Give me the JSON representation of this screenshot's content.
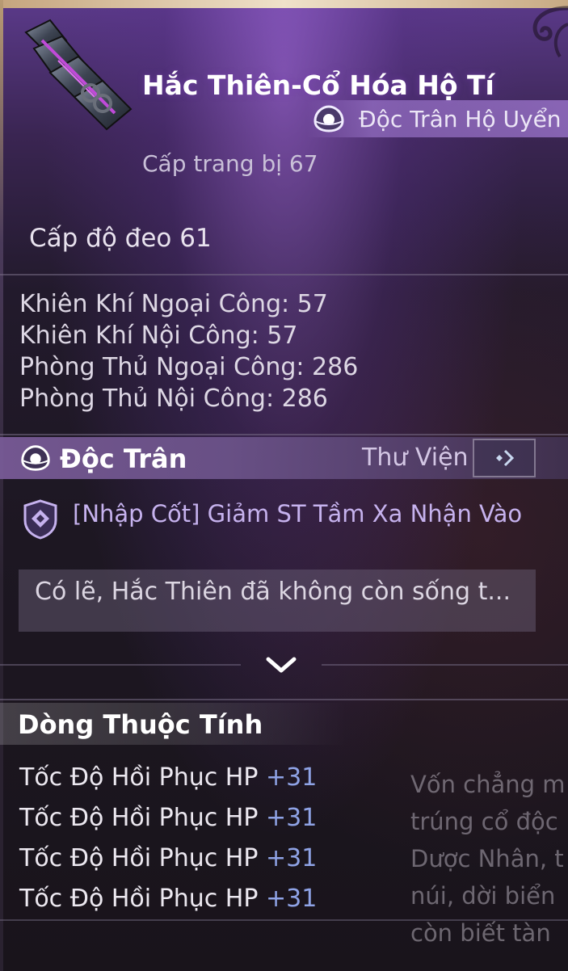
{
  "item": {
    "name": "Hắc Thiên-Cổ Hóa Hộ Tí",
    "type": "Độc Trân Hộ Uyển",
    "gear_level": "Cấp trang bị 67",
    "wear_level": "Cấp độ đeo 61"
  },
  "stats": [
    "Khiên Khí Ngoại Công: 57",
    "Khiên Khí Nội Công: 57",
    "Phòng Thủ Ngoại Công: 286",
    "Phòng Thủ Nội Công: 286"
  ],
  "section": {
    "title": "Độc Trân",
    "library_label": "Thư Viện"
  },
  "skill": {
    "text": "[Nhập Cốt] Giảm ST Tầm Xa Nhận Vào"
  },
  "description": {
    "text": "Có lẽ, Hắc Thiên đã không còn sống t..."
  },
  "attributes": {
    "title": "Dòng Thuộc Tính",
    "rows": [
      {
        "name": "Tốc Độ Hồi Phục HP",
        "value": "+31"
      },
      {
        "name": "Tốc Độ Hồi Phục HP",
        "value": "+31"
      },
      {
        "name": "Tốc Độ Hồi Phục HP",
        "value": "+31"
      },
      {
        "name": "Tốc Độ Hồi Phục HP",
        "value": "+31"
      }
    ]
  },
  "lore": [
    "Vốn chẳng m",
    "trúng cổ độc",
    "Dược Nhân, t",
    "núi, dời biển",
    "còn biết tàn"
  ],
  "colors": {
    "accent_purple": "#c6b2ee",
    "value_blue": "#8fa3e6",
    "badge_purple": "#a078d2"
  },
  "icons": {
    "item": "bracer-icon",
    "type": "pearl-icon",
    "skill": "shield-diamond-icon",
    "library": "arrow-right-icon",
    "expand": "chevron-down-icon"
  }
}
